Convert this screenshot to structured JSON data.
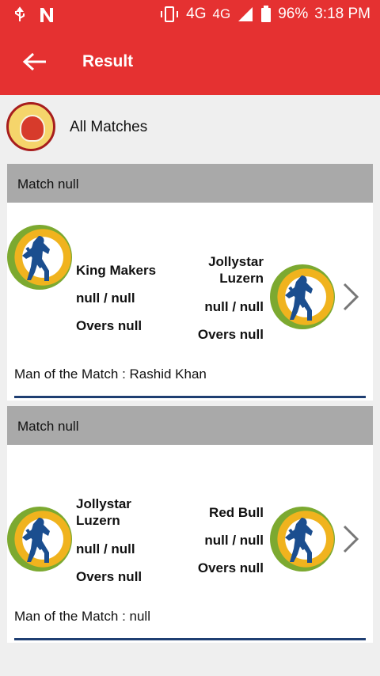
{
  "status_bar": {
    "network": "4G",
    "network_small": "4G",
    "battery": "96%",
    "time": "3:18 PM",
    "icons": [
      "usb-icon",
      "nfc-icon",
      "vibrate-icon",
      "signal-icon",
      "battery-icon"
    ]
  },
  "app_bar": {
    "title": "Result",
    "back_icon": "arrow-left-icon",
    "color": "#e53131"
  },
  "header": {
    "logo_icon": "club-logo-icon",
    "label": "All Matches"
  },
  "matches": [
    {
      "title": "Match null",
      "team1": {
        "name": "King Makers",
        "score": "null / null",
        "overs": "Overs null"
      },
      "team2": {
        "name": "Jollystar Luzern",
        "score": "null / null",
        "overs": "Overs null"
      },
      "man_of_match": "Man of the Match : Rashid Khan"
    },
    {
      "title": "Match null",
      "team1": {
        "name": "Jollystar Luzern",
        "score": "null / null",
        "overs": "Overs null"
      },
      "team2": {
        "name": "Red Bull",
        "score": "null / null",
        "overs": "Overs null"
      },
      "man_of_match": "Man of the Match : null"
    }
  ]
}
